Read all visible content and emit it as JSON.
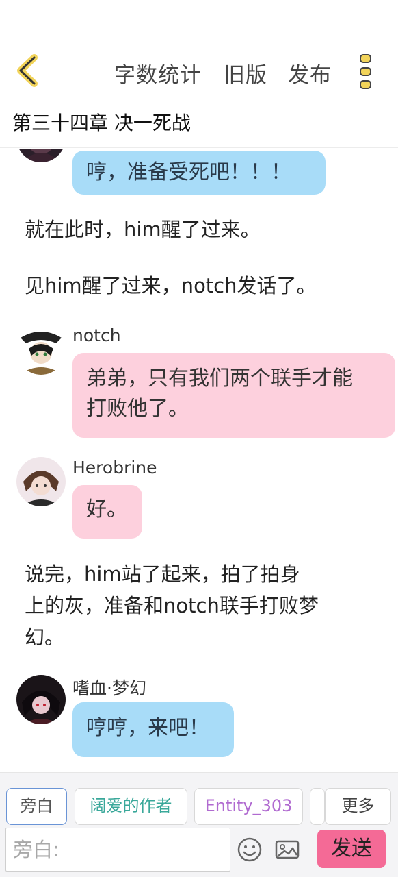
{
  "header": {
    "word_count_label": "字数统计",
    "old_version_label": "旧版",
    "publish_label": "发布",
    "chapter_title": "第三十四章 决一死战"
  },
  "messages": {
    "m1_text": "哼，准备受死吧！！！",
    "n1_text": "就在此时，him醒了过来。",
    "n2_text": "见him醒了过来，notch发话了。",
    "m2_name": "notch",
    "m2_line1": "弟弟，只有我们两个联手才能",
    "m2_line2": "打败他了。",
    "m3_name": "Herobrine",
    "m3_text": "好。",
    "n3_line1": "说完，him站了起来，拍了拍身",
    "n3_line2": "上的灰，准备和notch联手打败梦",
    "n3_line3": "幻。",
    "m4_name": "嗜血·梦幻",
    "m4_text": "哼哼，来吧！"
  },
  "composer": {
    "tabs": [
      "旁白",
      "阔爱的作者",
      "Entity_303",
      "更多"
    ],
    "input_placeholder": "旁白:",
    "send_label": "发送"
  },
  "colors": {
    "blue_bubble": "#a8dcf8",
    "pink_bubble": "#fdd0dd",
    "send_button": "#f46a96",
    "menu_accent": "#f2d45a"
  },
  "icons": [
    "back-arrow-icon",
    "more-vertical-icon",
    "emoji-icon",
    "image-icon"
  ]
}
